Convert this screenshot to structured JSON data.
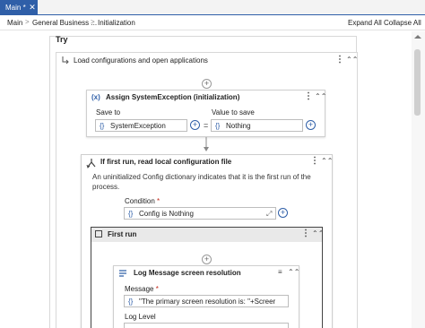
{
  "tabs": [
    {
      "label": "Main *",
      "close": "✕",
      "active": true
    }
  ],
  "breadcrumb": [
    "Main",
    "General Business ...",
    "Initialization"
  ],
  "header_actions": {
    "expand_all": "Expand All",
    "collapse_all": "Collapse All"
  },
  "workflow": {
    "try_label": "Try",
    "sequence_title": "Load configurations and open applications",
    "assign": {
      "title": "Assign SystemException (initialization)",
      "save_to_label": "Save to",
      "save_to_value": "SystemException",
      "value_label": "Value to save",
      "value": "Nothing",
      "equals": "="
    },
    "if_activity": {
      "title": "If first run, read local configuration file",
      "description": "An uninitialized Config dictionary indicates that it is the first run of the process.",
      "condition_label": "Condition",
      "required_mark": "*",
      "condition_value": "Config is Nothing"
    },
    "first_run": {
      "title": "First run",
      "log_message": {
        "title": "Log Message screen resolution",
        "message_label": "Message",
        "message_value": "\"The primary screen resolution is: \"+Screer",
        "log_level_label": "Log Level"
      }
    }
  },
  "icons": {
    "expression": "{}",
    "plus": "+",
    "kebab": "⋮",
    "collapse": "«",
    "expand": "⤢",
    "chevron": ">"
  },
  "colors": {
    "accent": "#2f5fa8",
    "required": "#c42b1c"
  }
}
